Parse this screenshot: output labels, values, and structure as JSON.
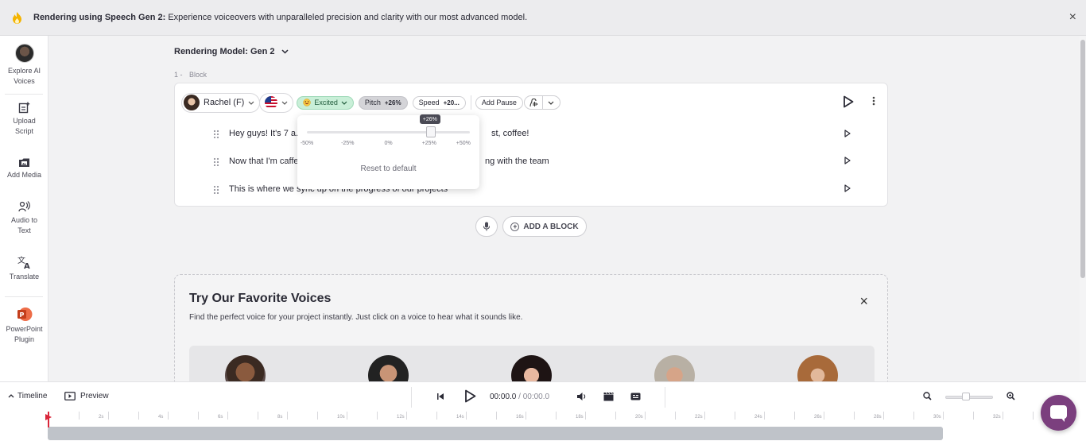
{
  "banner": {
    "title": "Rendering using Speech Gen 2:",
    "message": " Experience voiceovers with unparalleled precision and clarity with our most advanced model.",
    "close": "×"
  },
  "sidebar": {
    "items": [
      {
        "label": "Explore AI Voices"
      },
      {
        "label": "Upload Script"
      },
      {
        "label": "Add Media"
      },
      {
        "label": "Audio to Text"
      },
      {
        "label": "Translate"
      },
      {
        "label": "PowerPoint Plugin"
      }
    ]
  },
  "model": {
    "label": "Rendering Model: Gen 2"
  },
  "block": {
    "number": "1 -",
    "label": "Block",
    "voice": "Rachel (F)",
    "style": "Excited",
    "pitch_label": "Pitch",
    "pitch_value": "+26%",
    "speed_label": "Speed",
    "speed_value": "+20...",
    "pause_label": "Add Pause",
    "lines": [
      {
        "text_left": "Hey guys! It's 7 a.r",
        "text_right": "st, coffee!"
      },
      {
        "text_left": "Now that I'm caffe",
        "text_right": "ng with the team"
      },
      {
        "text_left": "This is where we sync up on the progress of our projects",
        "text_right": ""
      }
    ]
  },
  "pitch_popover": {
    "value": "+26%",
    "level": 0.76,
    "ticks": [
      "-50%",
      "-25%",
      "0%",
      "+25%",
      "+50%"
    ],
    "reset": "Reset to default"
  },
  "add_block": {
    "label": "ADD A BLOCK"
  },
  "favorites": {
    "title": "Try Our Favorite Voices",
    "description": "Find the perfect voice for your project instantly. Just click on a voice to hear what it sounds like.",
    "close": "×"
  },
  "bottombar": {
    "timeline": "Timeline",
    "preview": "Preview",
    "current_time": "00:00.0",
    "separator": " / ",
    "total_time": "00:00.0"
  },
  "ruler": {
    "labels": [
      "2s",
      "4s",
      "6s",
      "8s",
      "10s",
      "12s",
      "14s",
      "16s",
      "18s",
      "20s",
      "22s",
      "24s",
      "26s",
      "28s",
      "30s",
      "32s"
    ]
  },
  "colors": {
    "accent": "#7b3f7e",
    "excited_bg": "#c9efd8",
    "playhead": "#d9263a"
  }
}
